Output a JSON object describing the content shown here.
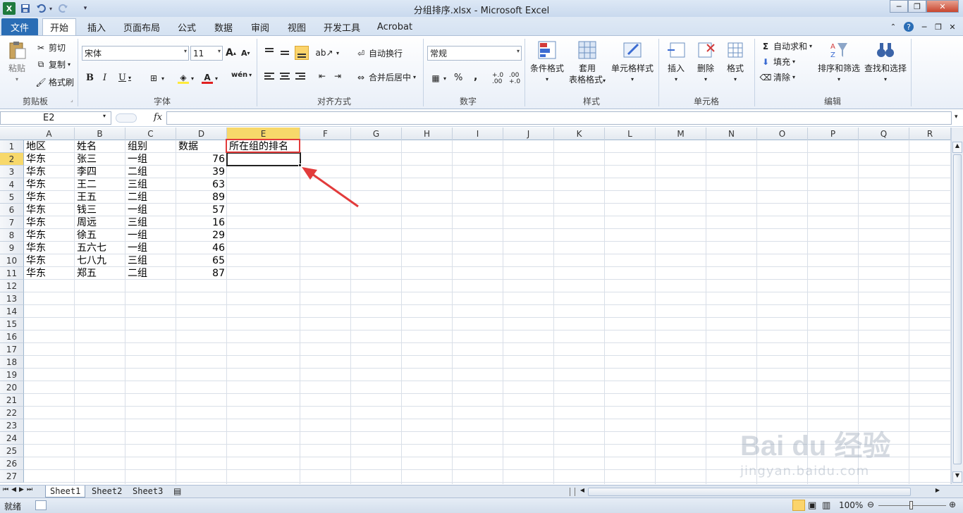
{
  "window": {
    "title": "分组排序.xlsx  -  Microsoft Excel",
    "controls": {
      "minimize": "─",
      "maximize": "❐",
      "close": "✕"
    }
  },
  "qat": {
    "save_icon": "save-icon",
    "undo_icon": "undo-icon",
    "redo_icon": "redo-icon"
  },
  "tabs": [
    {
      "id": "file",
      "label": "文件"
    },
    {
      "id": "home",
      "label": "开始"
    },
    {
      "id": "insert",
      "label": "插入"
    },
    {
      "id": "layout",
      "label": "页面布局"
    },
    {
      "id": "formula",
      "label": "公式"
    },
    {
      "id": "data",
      "label": "数据"
    },
    {
      "id": "review",
      "label": "审阅"
    },
    {
      "id": "view",
      "label": "视图"
    },
    {
      "id": "dev",
      "label": "开发工具"
    },
    {
      "id": "acrobat",
      "label": "Acrobat"
    }
  ],
  "ribbon": {
    "clipboard": {
      "paste": "粘贴",
      "cut": "剪切",
      "copy": "复制",
      "format_painter": "格式刷",
      "group": "剪贴板"
    },
    "font": {
      "name": "宋体",
      "size": "11",
      "bold": "B",
      "italic": "I",
      "underline": "U",
      "grow": "A",
      "shrink": "A",
      "wen": "wén",
      "group": "字体"
    },
    "alignment": {
      "wrap": "自动换行",
      "merge": "合并后居中",
      "group": "对齐方式"
    },
    "number": {
      "format": "常规",
      "percent": "%",
      "comma": ",",
      "inc": "+.0 .00",
      "dec": ".00 +.0",
      "group": "数字"
    },
    "styles": {
      "conditional": "条件格式",
      "table1": "套用",
      "table2": "表格格式",
      "cell_styles": "单元格样式",
      "group": "样式"
    },
    "cells": {
      "insert": "插入",
      "delete": "删除",
      "format": "格式",
      "group": "单元格"
    },
    "editing": {
      "autosum": "自动求和",
      "fill": "填充",
      "clear": "清除",
      "sort": "排序和筛选",
      "find": "查找和选择",
      "group": "编辑"
    }
  },
  "formula_bar": {
    "name_box": "E2",
    "fx": "fx",
    "value": ""
  },
  "columns": [
    "A",
    "B",
    "C",
    "D",
    "E",
    "F",
    "G",
    "H",
    "I",
    "J",
    "K",
    "L",
    "M",
    "N",
    "O",
    "P",
    "Q",
    "R"
  ],
  "rows": [
    "1",
    "2",
    "3",
    "4",
    "5",
    "6",
    "7",
    "8",
    "9",
    "10",
    "11",
    "12",
    "13",
    "14",
    "15",
    "16",
    "17",
    "18",
    "19",
    "20",
    "21",
    "22",
    "23",
    "24",
    "25",
    "26",
    "27"
  ],
  "cells": {
    "headers": [
      "地区",
      "姓名",
      "组别",
      "数据",
      "所在组的排名"
    ],
    "data": [
      [
        "华东",
        "张三",
        "一组",
        "76"
      ],
      [
        "华东",
        "李四",
        "二组",
        "39"
      ],
      [
        "华东",
        "王二",
        "三组",
        "63"
      ],
      [
        "华东",
        "王五",
        "二组",
        "89"
      ],
      [
        "华东",
        "钱三",
        "一组",
        "57"
      ],
      [
        "华东",
        "周远",
        "三组",
        "16"
      ],
      [
        "华东",
        "徐五",
        "一组",
        "29"
      ],
      [
        "华东",
        "五六七",
        "一组",
        "46"
      ],
      [
        "华东",
        "七八九",
        "三组",
        "65"
      ],
      [
        "华东",
        "郑五",
        "二组",
        "87"
      ]
    ]
  },
  "sheets": [
    "Sheet1",
    "Sheet2",
    "Sheet3"
  ],
  "status": {
    "ready": "就绪",
    "zoom": "100%"
  },
  "watermark": {
    "brand": "Bai du 经验",
    "url": "jingyan.baidu.com"
  },
  "colors": {
    "accent": "#2a6db5",
    "annotation": "#e23b3b",
    "selected_header": "#f7d86a"
  }
}
